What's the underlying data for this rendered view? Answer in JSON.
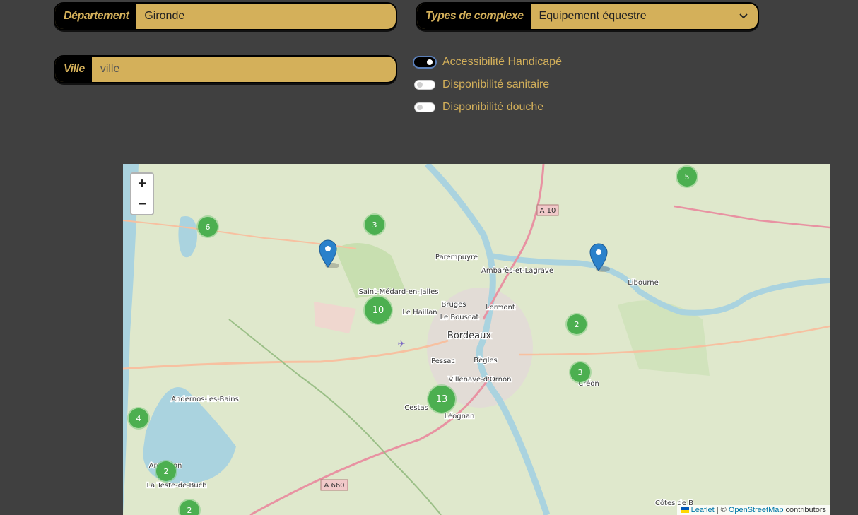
{
  "filters": {
    "departement_label": "Département",
    "departement_value": "Gironde",
    "types_label": "Types de complexe",
    "types_value": "Equipement équestre",
    "ville_label": "Ville",
    "ville_placeholder": "ville"
  },
  "toggles": [
    {
      "label": "Accessibilité Handicapé",
      "on": true
    },
    {
      "label": "Disponibilité sanitaire",
      "on": false
    },
    {
      "label": "Disponibilité douche",
      "on": false
    }
  ],
  "map": {
    "zoom_in": "+",
    "zoom_out": "−",
    "clusters": [
      "5",
      "6",
      "3",
      "10",
      "2",
      "3",
      "13",
      "4",
      "2",
      "2"
    ],
    "place_labels": [
      "Parempuyre",
      "Ambarès-et-Lagrave",
      "Libourne",
      "Saint-Médard-en-Jalles",
      "Le Haillan",
      "Bruges",
      "Lormont",
      "Le Bouscat",
      "Bordeaux",
      "Pessac",
      "Bègles",
      "Villenave-d'Ornon",
      "Créon",
      "Cestas",
      "Léognan",
      "Andernos-les-Bains",
      "Arcachon",
      "La Teste-de-Buch",
      "Côtes de B"
    ],
    "road_labels": [
      "A 10",
      "A 660"
    ],
    "attribution": {
      "leaflet": "Leaflet",
      "separator": " | © ",
      "osm": "OpenStreetMap",
      "suffix": " contributors"
    },
    "colors": {
      "cluster": "#4caf50",
      "marker": "#2a81cb",
      "water": "#aad3df",
      "land": "#dfe8cc"
    }
  }
}
